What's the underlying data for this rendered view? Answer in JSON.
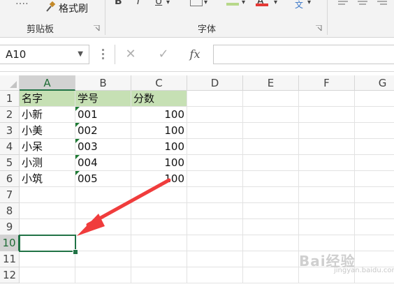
{
  "ribbon": {
    "format_painter_label": "格式刷",
    "clipboard_group": "剪贴板",
    "font_group": "字体"
  },
  "formula_bar": {
    "name_box": "A10",
    "fx_label": "fx",
    "formula": ""
  },
  "columns": [
    "A",
    "B",
    "C",
    "D",
    "E",
    "F",
    "G"
  ],
  "rows": [
    "1",
    "2",
    "3",
    "4",
    "5",
    "6",
    "7",
    "8",
    "9",
    "10",
    "11",
    "12"
  ],
  "sheet": {
    "header": [
      "名字",
      "学号",
      "分数"
    ],
    "data": [
      [
        "小新",
        "001",
        "100"
      ],
      [
        "小美",
        "002",
        "100"
      ],
      [
        "小呆",
        "003",
        "100"
      ],
      [
        "小测",
        "004",
        "100"
      ],
      [
        "小筑",
        "005",
        "100"
      ]
    ]
  },
  "selected_cell": "A10",
  "colors": {
    "header_fill": "#c6e0b4",
    "selection": "#217346",
    "arrow": "#f03c3c"
  },
  "watermark": {
    "text": "Bai经验",
    "sub": "jingyan.baidu.com"
  }
}
